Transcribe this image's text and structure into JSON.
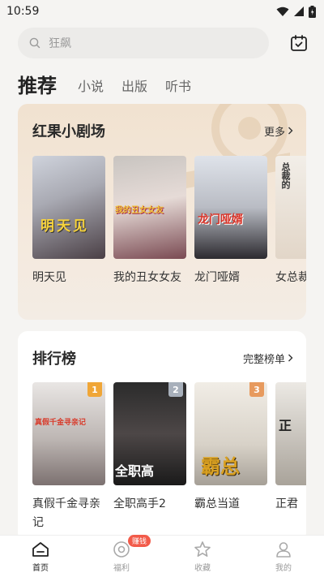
{
  "status": {
    "time": "10:59"
  },
  "search": {
    "placeholder": "狂飙"
  },
  "tabs": [
    {
      "label": "推荐",
      "active": true
    },
    {
      "label": "小说",
      "active": false
    },
    {
      "label": "出版",
      "active": false
    },
    {
      "label": "听书",
      "active": false
    }
  ],
  "drama": {
    "title": "红果小剧场",
    "more": "更多",
    "items": [
      {
        "title": "明天见",
        "cover_text": "明天见"
      },
      {
        "title": "我的丑女女友",
        "cover_text": "我的丑女女友"
      },
      {
        "title": "龙门哑婿",
        "cover_text": "龙门哑婿"
      },
      {
        "title": "女总裁爱人",
        "cover_text": "总裁的"
      }
    ]
  },
  "ranking": {
    "title": "排行榜",
    "more": "完整榜单",
    "items": [
      {
        "rank": "1",
        "title": "真假千金寻亲记",
        "cover_text": "真假千金寻亲记"
      },
      {
        "rank": "2",
        "title": "全职高手2",
        "cover_text": "全职高"
      },
      {
        "rank": "3",
        "title": "霸总当道",
        "cover_text": "霸总"
      },
      {
        "rank": "",
        "title": "正君",
        "cover_text": "正"
      }
    ]
  },
  "nav": {
    "home": "首页",
    "welfare": "福利",
    "welfare_badge": "赚钱",
    "favorites": "收藏",
    "mine": "我的"
  },
  "colors": {
    "accent": "#f25b4a",
    "rank1": "#f0a637",
    "rank2": "#a8b0bb",
    "rank3": "#e79a5e"
  }
}
